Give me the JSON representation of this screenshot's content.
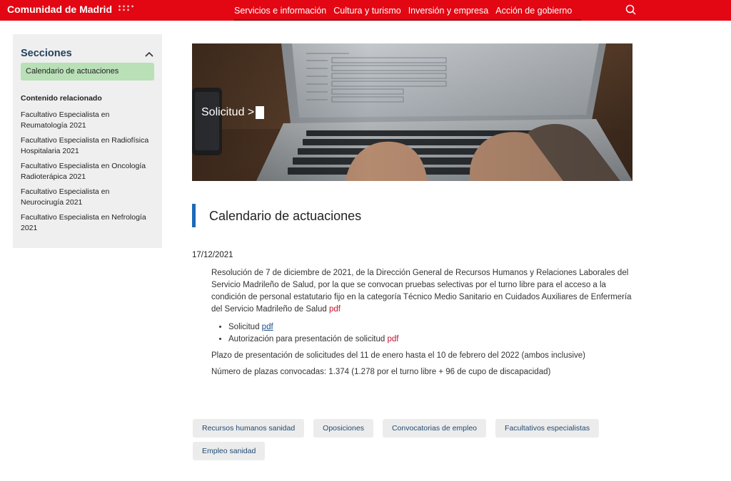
{
  "header": {
    "brand": "Comunidad de Madrid",
    "stars": [
      "✶✶✶✶",
      "✶✶✶"
    ],
    "nav": [
      "Servicios e información",
      "Cultura y turismo",
      "Inversión y empresa",
      "Acción de gobierno"
    ],
    "search_icon": "search-icon"
  },
  "sidebar": {
    "title": "Secciones",
    "active_item": "Calendario de actuaciones",
    "related_title": "Contenido relacionado",
    "related": [
      "Facultativo Especialista en Reumatología 2021",
      "Facultativo Especialista en Radiofísica Hospitalaria 2021",
      "Facultativo Especialista en Oncología Radioterápica 2021",
      "Facultativo Especialista en Neurocirugía 2021",
      "Facultativo Especialista en Nefrología 2021"
    ]
  },
  "hero": {
    "label": "Solicitud >"
  },
  "main": {
    "heading": "Calendario de actuaciones",
    "date": "17/12/2021",
    "resolution_text": "Resolución de 7 de diciembre de 2021, de la Dirección General de Recursos Humanos y Relaciones Laborales del Servicio Madrileño de Salud, por la que se convocan pruebas selectivas por el turno libre para el acceso a la condición de personal estatutario fijo en la categoría Técnico Medio Sanitario en Cuidados Auxiliares de Enfermería del Servicio Madrileño de Salud",
    "resolution_link": "pdf",
    "bullets": [
      {
        "text": "Solicitud",
        "link": "pdf"
      },
      {
        "text": "Autorización para presentación de solicitud",
        "link": "pdf"
      }
    ],
    "plazo": "Plazo de presentación de solicitudes del 11 de enero hasta el 10 de febrero del 2022 (ambos inclusive)",
    "plazas": "Número de plazas convocadas: 1.374 (1.278 por el turno libre + 96 de cupo de discapacidad)"
  },
  "tags": [
    "Recursos humanos sanidad",
    "Oposiciones",
    "Convocatorias de empleo",
    "Facultativos especialistas",
    "Empleo sanidad"
  ],
  "colors": {
    "brand_red": "#e30613",
    "active_green": "#b9e0b7",
    "heading_blue": "#1b6ab8"
  }
}
